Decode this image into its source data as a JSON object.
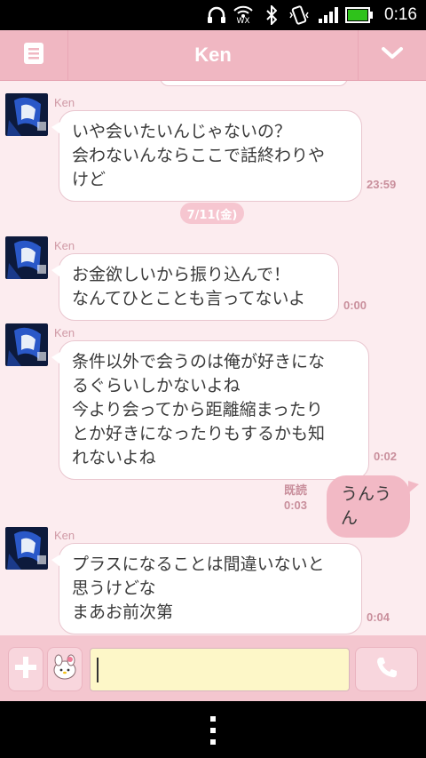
{
  "status_bar": {
    "time": "0:16",
    "wifi_label": "WX"
  },
  "header": {
    "title": "Ken",
    "menu_icon": "menu-icon",
    "dropdown_icon": "chevron-down-icon"
  },
  "messages": [
    {
      "sender": "Ken",
      "lines": [
        "いや会いたいんじゃないの？",
        "会わないんならここで話終わりや",
        "けど"
      ],
      "time": "23:59"
    },
    {
      "date": "7/11(金)"
    },
    {
      "sender": "Ken",
      "lines": [
        "お金欲しいから振り込んで！",
        "なんてひとことも言ってないよ"
      ],
      "time": "0:00"
    },
    {
      "sender": "Ken",
      "lines": [
        "条件以外で会うのは俺が好きにな",
        "るぐらいしかないよね",
        "今より会ってから距離縮まったり",
        "とか好きになったりもするかも知",
        "れないよね"
      ],
      "time": "0:02"
    },
    {
      "outgoing": true,
      "text": "うんうん",
      "read": "既読",
      "time": "0:03"
    },
    {
      "sender": "Ken",
      "lines": [
        "プラスになることは間違いないと",
        "思うけどな",
        "まあお前次第"
      ],
      "time": "0:04"
    }
  ],
  "input": {
    "value": "",
    "plus_icon": "plus-icon",
    "sticker_icon": "sticker-icon",
    "call_icon": "phone-icon"
  },
  "colors": {
    "accent": "#f0b7c2",
    "background": "#fcecef",
    "bubble_out": "#f2b9c5"
  }
}
